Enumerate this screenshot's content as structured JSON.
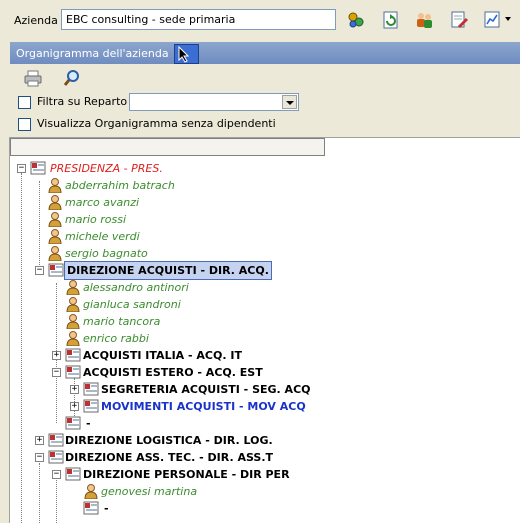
{
  "header": {
    "azienda_label": "Azienda",
    "azienda_value": "EBC consulting - sede primaria"
  },
  "panel": {
    "title": "Organigramma dell'azienda"
  },
  "filters": {
    "filtra_label": "Filtra su Reparto",
    "filtra_value": "",
    "visualizza_label": "Visualizza Organigramma senza dipendenti"
  },
  "tree": {
    "items": [
      {
        "label": "PRESIDENZA - PRES."
      },
      {
        "label": "abderrahim batrach"
      },
      {
        "label": "marco avanzi"
      },
      {
        "label": "mario rossi"
      },
      {
        "label": "michele verdi"
      },
      {
        "label": "sergio bagnato"
      },
      {
        "label": "DIREZIONE ACQUISTI - DIR. ACQ."
      },
      {
        "label": "alessandro antinori"
      },
      {
        "label": "gianluca sandroni"
      },
      {
        "label": "mario tancora"
      },
      {
        "label": "enrico rabbi"
      },
      {
        "label": "ACQUISTI ITALIA - ACQ. IT"
      },
      {
        "label": "ACQUISTI ESTERO - ACQ. EST"
      },
      {
        "label": "SEGRETERIA ACQUISTI - SEG. ACQ"
      },
      {
        "label": "MOVIMENTI ACQUISTI - MOV ACQ"
      },
      {
        "label": "-"
      },
      {
        "label": "DIREZIONE LOGISTICA - DIR. LOG."
      },
      {
        "label": "DIREZIONE ASS. TEC. - DIR. ASS.T"
      },
      {
        "label": "DIREZIONE PERSONALE - DIR PER"
      },
      {
        "label": "genovesi martina"
      },
      {
        "label": "-"
      }
    ]
  },
  "colors": {
    "person": "#3B8C2E",
    "root": "#E02020",
    "link": "#1A33C9",
    "selection": "#C5D3F0"
  },
  "icons": [
    "gear-people-icon",
    "refresh-icon",
    "users-icon",
    "document-pen-icon",
    "chart-icon",
    "print-icon",
    "search-icon",
    "org-node-icon",
    "person-icon"
  ]
}
